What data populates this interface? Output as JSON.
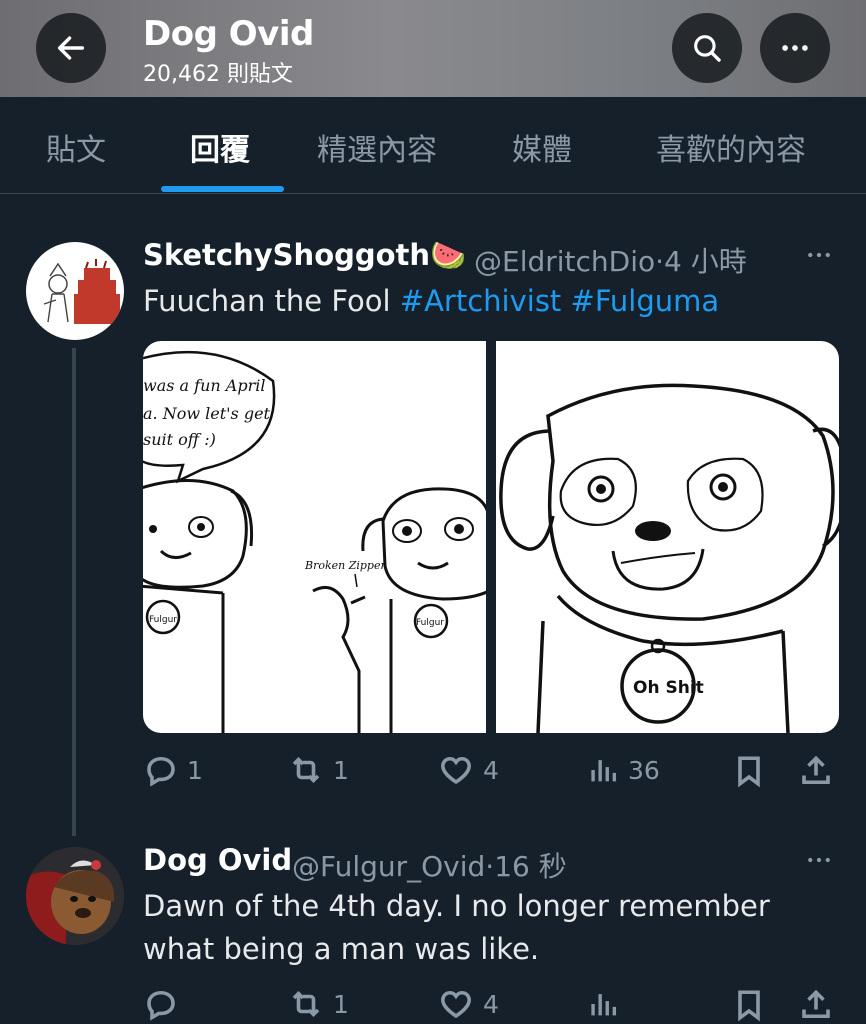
{
  "header": {
    "back_icon": "arrow-left-icon",
    "title": "Dog Ovid",
    "post_count": "20,462 則貼文",
    "search_icon": "search-icon",
    "more_icon": "more-horizontal-icon"
  },
  "tabs": [
    {
      "label": "貼文",
      "active": false
    },
    {
      "label": "回覆",
      "active": true
    },
    {
      "label": "精選內容",
      "active": false
    },
    {
      "label": "媒體",
      "active": false
    },
    {
      "label": "喜歡的內容",
      "active": false
    }
  ],
  "tweets": [
    {
      "display_name": "SketchyShoggoth",
      "name_emoji": "🍉",
      "handle": "@EldritchDio",
      "sep": "·",
      "time": "4 小時",
      "text_plain": "Fuuchan the Fool ",
      "hashtags": [
        "#Artchivist",
        "#Fulguma"
      ],
      "media_panels": [
        "comic-panel-left",
        "comic-panel-right"
      ],
      "comic_text": {
        "speech": [
          "was a fun April",
          "a. Now let's get",
          "suit off :)"
        ],
        "zipper_note": "Broken Zipper",
        "tag_left": "Fulgur",
        "tag_mid": "Fulgur",
        "tag_right": "Oh Shit"
      },
      "actions": {
        "replies": "1",
        "retweets": "1",
        "likes": "4",
        "views": "36"
      }
    },
    {
      "display_name": "Dog Ovid",
      "handle": "@Fulgur_Ovid",
      "sep": "·",
      "time": "16 秒",
      "text_line1": "Dawn of the 4th day. I no longer remember",
      "text_line2": "what being a man was like.",
      "actions": {
        "replies": "",
        "retweets": "1",
        "likes": "4",
        "views": ""
      }
    }
  ],
  "colors": {
    "background": "#15202b",
    "accent": "#1d9bf0",
    "muted": "#8b98a5",
    "divider": "#38444d"
  }
}
